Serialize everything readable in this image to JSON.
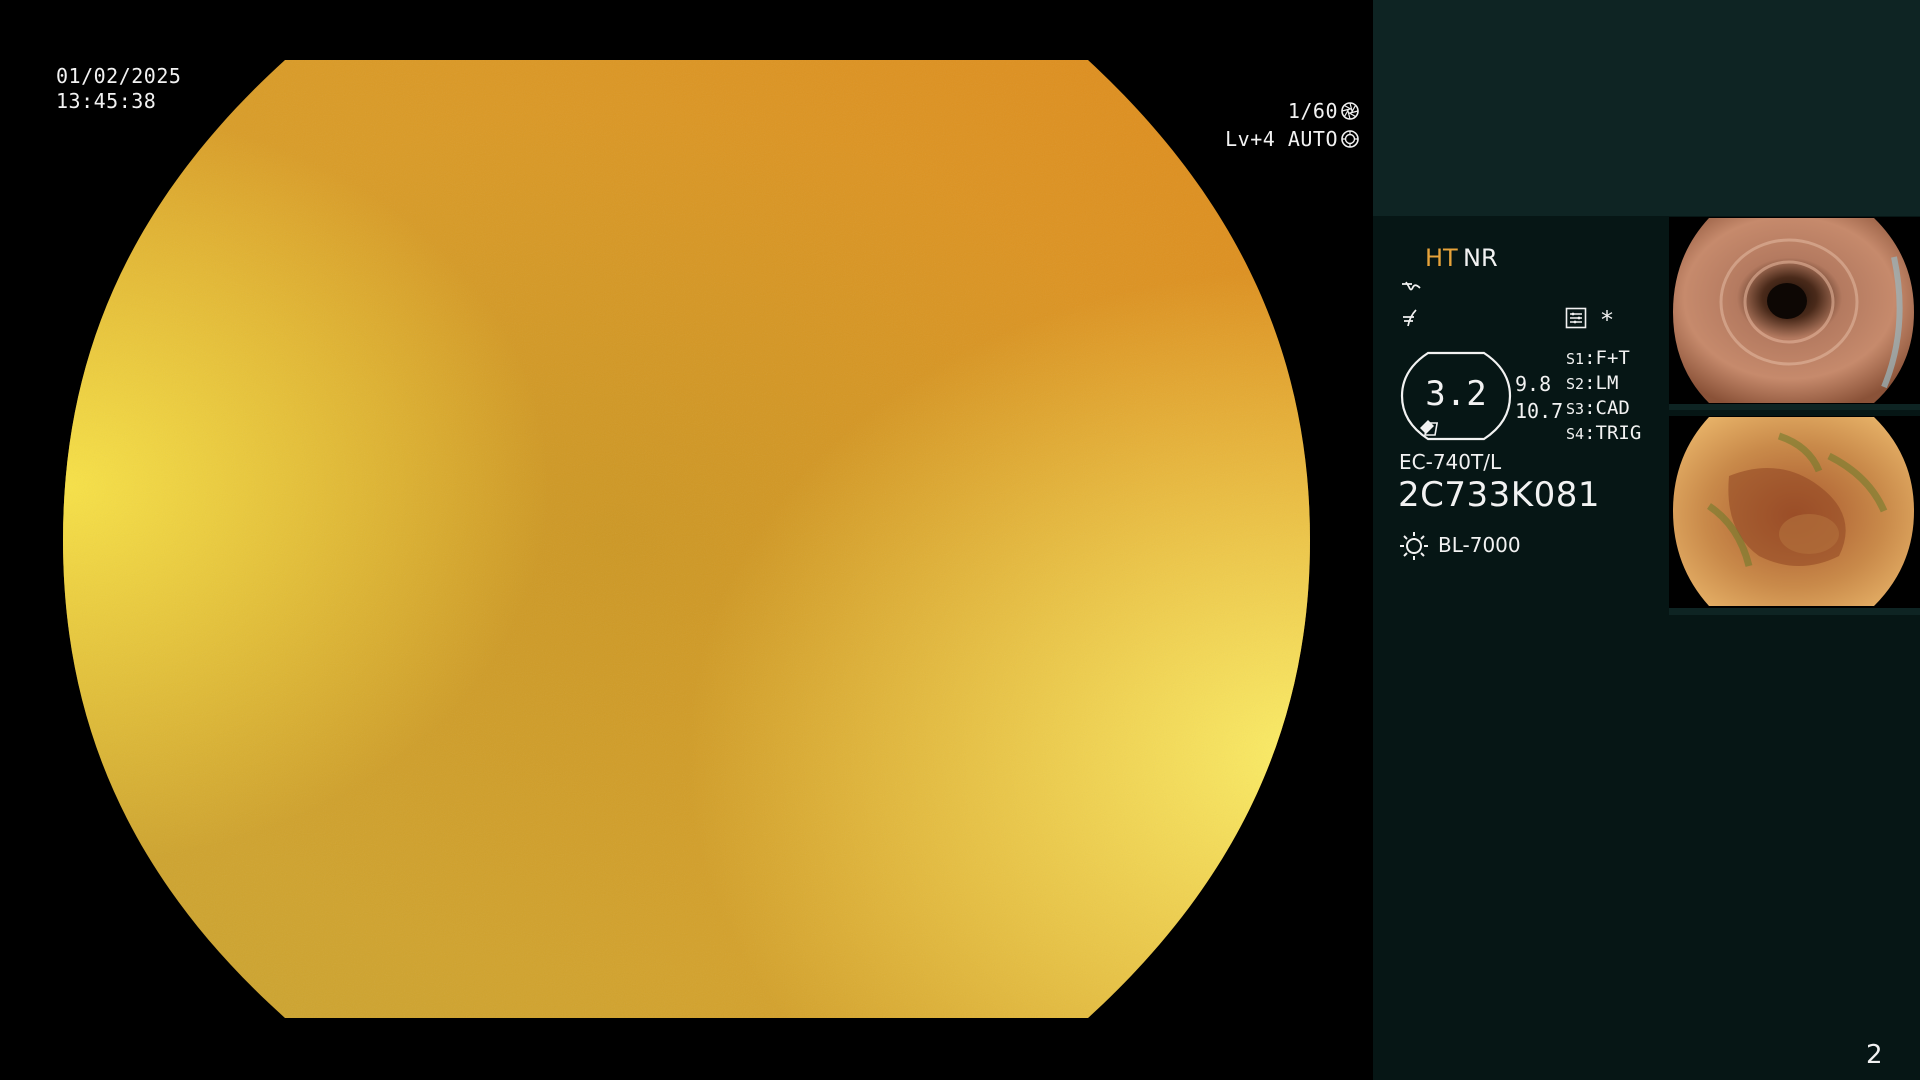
{
  "overlay": {
    "date": "01/02/2025",
    "time": "13:45:38",
    "shutter": "1/60",
    "level": "Lv+4",
    "iris_mode": "AUTO",
    "shutter_icon": "aperture-icon",
    "iris_icon": "iris-ring-icon"
  },
  "panel": {
    "ht_label": "HT",
    "nr_label": "NR",
    "filter_icons": [
      "enhancement-curve-icon",
      "structure-emphasis-icon"
    ],
    "menu_icon": "settings-list-icon",
    "asterisk": "*",
    "zoom": "3.2",
    "value_a": "9.8",
    "value_b": "10.7",
    "switches": [
      {
        "key": "S1",
        "value": "F+T"
      },
      {
        "key": "S2",
        "value": "LM"
      },
      {
        "key": "S3",
        "value": "CAD"
      },
      {
        "key": "S4",
        "value": "TRIG"
      }
    ],
    "scope_model": "EC-740T/L",
    "serial": "2C733K081",
    "light_source": "BL-7000",
    "lamp_icon": "lamp-icon",
    "page_number": "2"
  },
  "thumbnails": [
    {
      "index": 1,
      "name": "captured-frame-lumen"
    },
    {
      "index": 2,
      "name": "captured-frame-mucosa"
    }
  ],
  "colors": {
    "ht_accent": "#e7a33a",
    "panel_bg": "#061615",
    "panel_top_band": "#0e2423",
    "scope_image": "#d6a027"
  }
}
